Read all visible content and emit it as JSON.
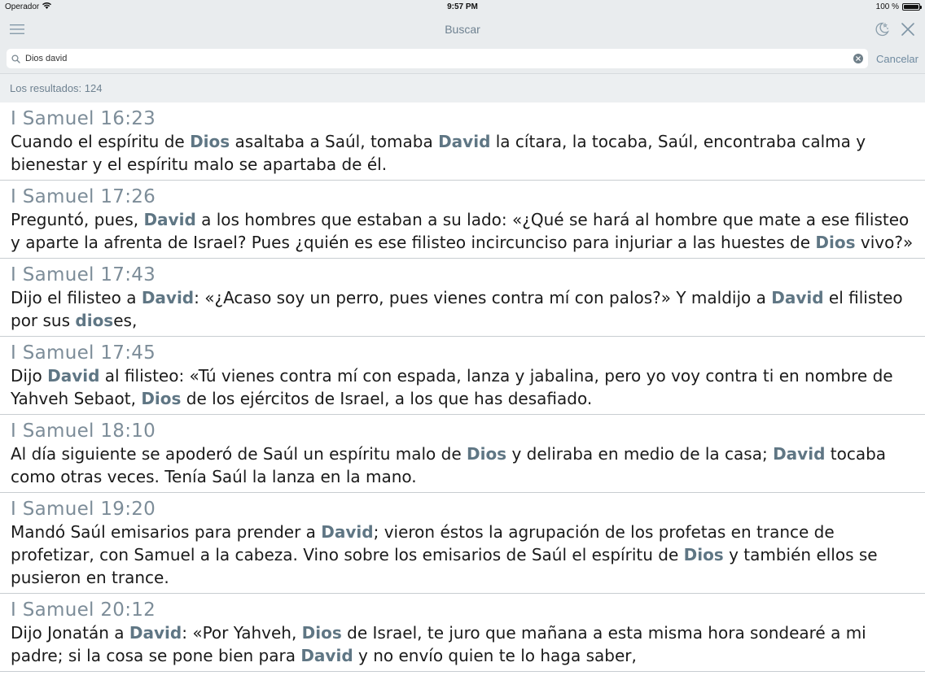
{
  "status": {
    "carrier": "Operador",
    "time": "9:57 PM",
    "battery": "100 %",
    "battery_level": 1.0
  },
  "nav": {
    "title": "Buscar",
    "menu_icon": "menu-icon",
    "night_icon": "moon-stars-icon",
    "close_icon": "close-icon"
  },
  "search": {
    "value": "Dios david",
    "placeholder": "",
    "cancel_label": "Cancelar"
  },
  "results_label": "Los resultados: 124",
  "colors": {
    "bars": "#e9ecee",
    "title": "#6f8291",
    "highlight": "#5f7684",
    "reference": "#7d8d99"
  },
  "results": [
    {
      "ref": "I Samuel 16:23",
      "segments": [
        {
          "t": "Cuando el espíritu de "
        },
        {
          "t": "Dios",
          "h": true
        },
        {
          "t": " asaltaba a Saúl, tomaba "
        },
        {
          "t": "David",
          "h": true
        },
        {
          "t": " la cítara, la tocaba, Saúl, encontraba calma y bienestar y el espíritu malo se apartaba de él."
        }
      ]
    },
    {
      "ref": "I Samuel 17:26",
      "segments": [
        {
          "t": "Preguntó, pues, "
        },
        {
          "t": "David",
          "h": true
        },
        {
          "t": " a los hombres que estaban a su lado: «¿Qué se hará al hombre que mate a ese filisteo y aparte la afrenta de Israel? Pues ¿quién es ese filisteo incircunciso para injuriar a las huestes de "
        },
        {
          "t": "Dios",
          "h": true
        },
        {
          "t": " vivo?»"
        }
      ]
    },
    {
      "ref": "I Samuel 17:43",
      "segments": [
        {
          "t": "Dijo el filisteo a "
        },
        {
          "t": "David",
          "h": true
        },
        {
          "t": ": «¿Acaso soy un perro, pues vienes contra mí con palos?» Y maldijo a "
        },
        {
          "t": "David",
          "h": true
        },
        {
          "t": " el filisteo por sus "
        },
        {
          "t": "dios",
          "h": true
        },
        {
          "t": "es,"
        }
      ]
    },
    {
      "ref": "I Samuel 17:45",
      "segments": [
        {
          "t": "Dijo "
        },
        {
          "t": "David",
          "h": true
        },
        {
          "t": " al filisteo: «Tú vienes contra mí con espada, lanza y jabalina, pero yo voy contra ti en nombre de Yahveh Sebaot, "
        },
        {
          "t": "Dios",
          "h": true
        },
        {
          "t": " de los ejércitos de Israel, a los que has desafiado."
        }
      ]
    },
    {
      "ref": "I Samuel 18:10",
      "segments": [
        {
          "t": "Al día siguiente se apoderó de Saúl un espíritu malo de "
        },
        {
          "t": "Dios",
          "h": true
        },
        {
          "t": " y deliraba en medio de la casa; "
        },
        {
          "t": "David",
          "h": true
        },
        {
          "t": " tocaba como otras veces. Tenía Saúl la lanza en la mano."
        }
      ]
    },
    {
      "ref": "I Samuel 19:20",
      "segments": [
        {
          "t": "Mandó Saúl emisarios para prender a "
        },
        {
          "t": "David",
          "h": true
        },
        {
          "t": "; vieron éstos la agrupación de los profetas en trance de profetizar, con Samuel a la cabeza. Vino sobre los emisarios de Saúl el espíritu de "
        },
        {
          "t": "Dios",
          "h": true
        },
        {
          "t": " y también ellos se pusieron en trance."
        }
      ]
    },
    {
      "ref": "I Samuel 20:12",
      "segments": [
        {
          "t": "Dijo Jonatán a "
        },
        {
          "t": "David",
          "h": true
        },
        {
          "t": ": «Por Yahveh, "
        },
        {
          "t": "Dios",
          "h": true
        },
        {
          "t": " de Israel, te juro que mañana a esta misma hora sondearé a mi padre; si la cosa se pone bien para "
        },
        {
          "t": "David",
          "h": true
        },
        {
          "t": " y no envío quien te lo haga saber,"
        }
      ]
    }
  ]
}
